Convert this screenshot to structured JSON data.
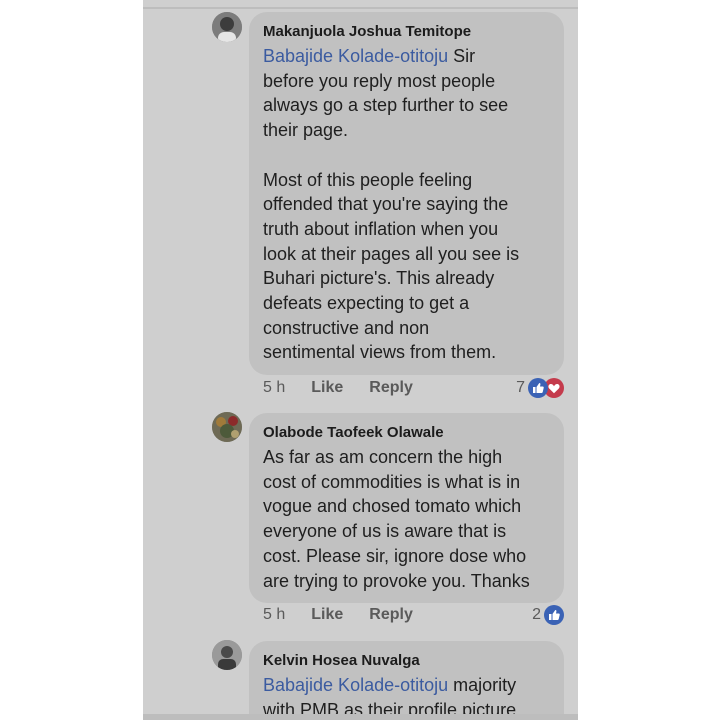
{
  "comments": [
    {
      "author": "Makanjuola Joshua Temitope",
      "lines": [
        {
          "mention": "Babajide Kolade-otitoju",
          "text": " Sir"
        },
        {
          "mention": "",
          "text": "before you reply most people"
        },
        {
          "mention": "",
          "text": "always go a step further to see"
        },
        {
          "mention": "",
          "text": "their page."
        },
        {
          "mention": "",
          "text": ""
        },
        {
          "mention": "",
          "text": "Most of this people feeling"
        },
        {
          "mention": "",
          "text": "offended that you're saying the"
        },
        {
          "mention": "",
          "text": "truth about inflation when you"
        },
        {
          "mention": "",
          "text": "look at their pages all you see is"
        },
        {
          "mention": "",
          "text": "Buhari picture's. This already"
        },
        {
          "mention": "",
          "text": "defeats expecting to get a"
        },
        {
          "mention": "",
          "text": "constructive and non"
        },
        {
          "mention": "",
          "text": "sentimental views from them."
        }
      ],
      "time": "5 h",
      "like_label": "Like",
      "reply_label": "Reply",
      "reaction_count": "7",
      "reactions": [
        "like-icon",
        "love-icon"
      ]
    },
    {
      "author": "Olabode Taofeek Olawale",
      "lines": [
        {
          "mention": "",
          "text": "As far as am concern the high"
        },
        {
          "mention": "",
          "text": "cost of commodities is what is in"
        },
        {
          "mention": "",
          "text": "vogue and chosed tomato which"
        },
        {
          "mention": "",
          "text": "everyone of us is aware that is"
        },
        {
          "mention": "",
          "text": "cost. Please sir, ignore dose who"
        },
        {
          "mention": "",
          "text": "are trying to provoke you. Thanks"
        }
      ],
      "time": "5 h",
      "like_label": "Like",
      "reply_label": "Reply",
      "reaction_count": "2",
      "reactions": [
        "like-icon"
      ]
    },
    {
      "author": "Kelvin Hosea Nuvalga",
      "lines": [
        {
          "mention": "Babajide Kolade-otitoju",
          "text": " majority"
        },
        {
          "mention": "",
          "text": "with PMB as their profile picture"
        }
      ]
    }
  ],
  "colors": {
    "background": "#cfcfcf",
    "bubble": "#c1c1c1",
    "mention": "#3b5ba0",
    "like": "#3a62b5",
    "love": "#c43b4c"
  }
}
